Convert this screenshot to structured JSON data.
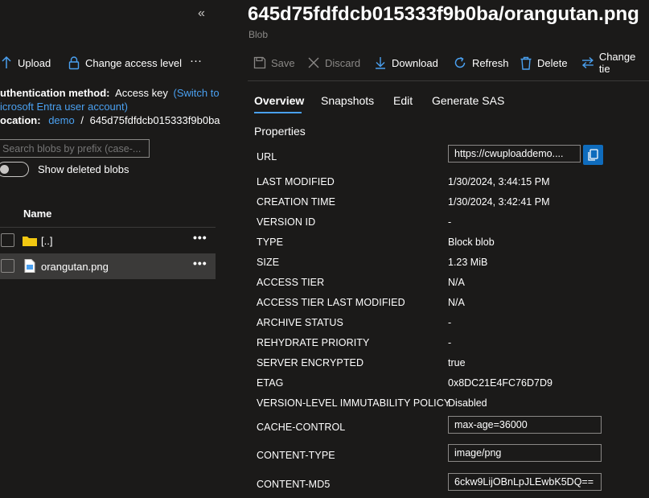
{
  "left": {
    "collapse_glyph": "«",
    "toolbar": {
      "upload": "Upload",
      "change_access": "Change access level",
      "more": "···"
    },
    "auth_label": "uthentication method:",
    "auth_value": "Access key",
    "auth_link_1": "(Switch to",
    "auth_link_2": "icrosoft Entra user account)",
    "location_label": "ocation:",
    "location_link": "demo",
    "location_sep": "/",
    "location_path": "645d75fdfdcb015333f9b0ba",
    "search_placeholder": "Search blobs by prefix (case-...",
    "show_deleted": "Show deleted blobs",
    "column_name": "Name",
    "rows": [
      {
        "name": "[..]"
      },
      {
        "name": "orangutan.png"
      }
    ],
    "row_more": "•••"
  },
  "header": {
    "title": "645d75fdfdcb015333f9b0ba/orangutan.png",
    "subtitle": "Blob"
  },
  "toolbar": {
    "save": "Save",
    "discard": "Discard",
    "download": "Download",
    "refresh": "Refresh",
    "delete": "Delete",
    "change_tier": "Change tie"
  },
  "tabs": [
    "Overview",
    "Snapshots",
    "Edit",
    "Generate SAS"
  ],
  "section_title": "Properties",
  "properties": {
    "url_label": "URL",
    "url_value": "https://cwuploaddemo....",
    "rows": [
      {
        "label": "LAST MODIFIED",
        "value": "1/30/2024, 3:44:15 PM"
      },
      {
        "label": "CREATION TIME",
        "value": "1/30/2024, 3:42:41 PM"
      },
      {
        "label": "VERSION ID",
        "value": "-"
      },
      {
        "label": "TYPE",
        "value": "Block blob"
      },
      {
        "label": "SIZE",
        "value": "1.23 MiB"
      },
      {
        "label": "ACCESS TIER",
        "value": "N/A"
      },
      {
        "label": "ACCESS TIER LAST MODIFIED",
        "value": "N/A"
      },
      {
        "label": "ARCHIVE STATUS",
        "value": "-"
      },
      {
        "label": "REHYDRATE PRIORITY",
        "value": "-"
      },
      {
        "label": "SERVER ENCRYPTED",
        "value": "true"
      },
      {
        "label": "ETAG",
        "value": "0x8DC21E4FC76D7D9"
      },
      {
        "label": "VERSION-LEVEL IMMUTABILITY POLICY",
        "value": "Disabled"
      }
    ],
    "cache_control_label": "CACHE-CONTROL",
    "cache_control_value": "max-age=36000",
    "content_type_label": "CONTENT-TYPE",
    "content_type_value": "image/png",
    "content_md5_label": "CONTENT-MD5",
    "content_md5_value": "6ckw9LijOBnLpJLEwbK5DQ=="
  },
  "colors": {
    "accent": "#4aa0f0",
    "background": "#1b1a19",
    "selected_row": "#3b3a39",
    "folder": "#f2c811"
  }
}
